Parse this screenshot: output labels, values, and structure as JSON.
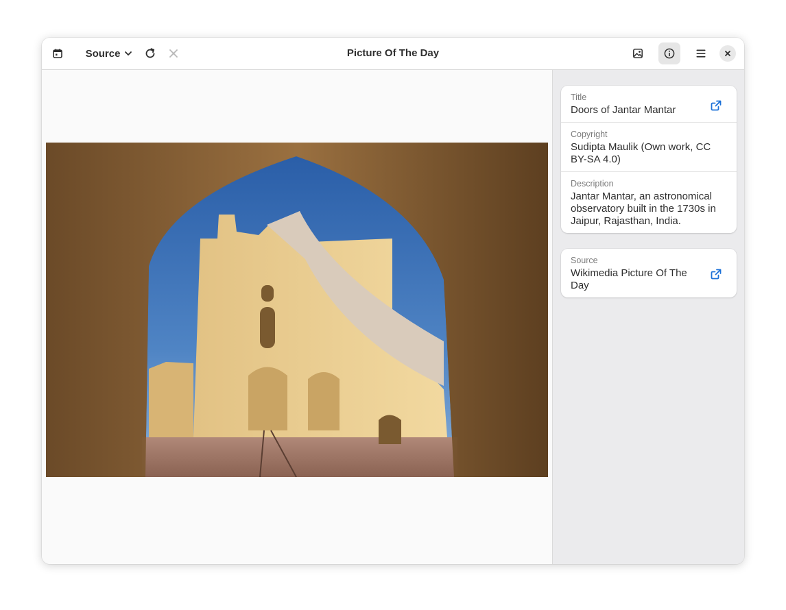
{
  "window": {
    "title": "Picture Of The Day"
  },
  "header": {
    "source_label": "Source",
    "icons": {
      "calendar": "calendar-icon",
      "dropdown": "chevron-down-icon",
      "refresh": "refresh-icon",
      "stop": "close-x-icon",
      "image": "image-icon",
      "info": "info-icon",
      "menu": "hamburger-menu-icon",
      "close": "window-close-icon"
    }
  },
  "photo": {
    "subject": "arched doorway framing the Jantar Mantar sundial, blue sky"
  },
  "info_panel": {
    "title_caption": "Title",
    "title_value": "Doors of Jantar Mantar",
    "copyright_caption": "Copyright",
    "copyright_value": "Sudipta Maulik (Own work, CC BY-SA 4.0)",
    "description_caption": "Description",
    "description_value": "Jantar Mantar, an astronomical observatory built in the 1730s in Jaipur, Rajasthan, India.",
    "source_caption": "Source",
    "source_value": "Wikimedia Picture Of The Day"
  },
  "colors": {
    "accent": "#1c71d8",
    "sidebar_bg": "#ebebed",
    "content_bg": "#fafafa",
    "text": "#2e2e2e"
  }
}
